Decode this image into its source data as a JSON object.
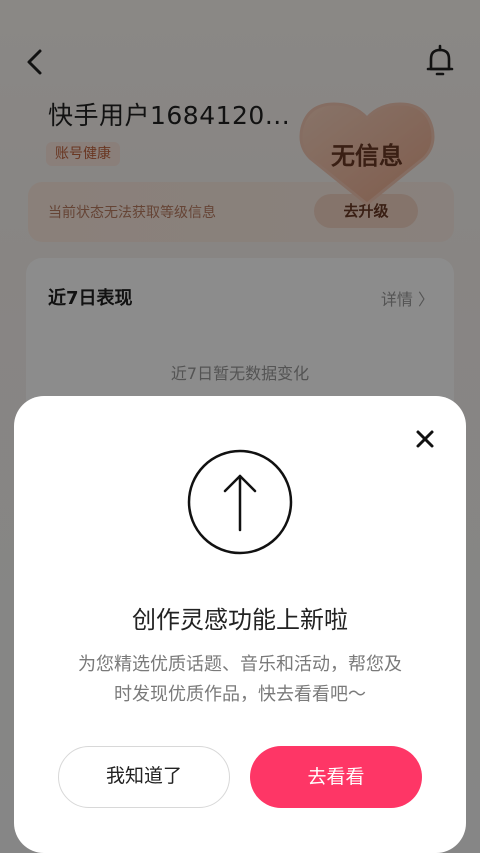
{
  "header": {
    "back_icon": "chevron-left-icon",
    "bell_icon": "bell-icon"
  },
  "profile": {
    "username": "快手用户1684120...",
    "health_badge": "账号健康",
    "level_badge_text": "无信息",
    "level_card": {
      "text": "当前状态无法获取等级信息",
      "button": "去升级"
    }
  },
  "stats": {
    "title": "近7日表现",
    "detail_link": "详情 〉",
    "empty_text": "近7日暂无数据变化"
  },
  "modal": {
    "close_icon": "close-icon",
    "illustration_icon": "arrow-up-circle-icon",
    "title": "创作灵感功能上新啦",
    "description_line1": "为您精选优质话题、音乐和活动，帮您及",
    "description_line2": "时发现优质作品，快去看看吧～",
    "secondary_button": "我知道了",
    "primary_button": "去看看"
  },
  "colors": {
    "primary": "#fe3666",
    "accent_brown": "#6a3a25",
    "badge_bg": "#fce7df"
  }
}
